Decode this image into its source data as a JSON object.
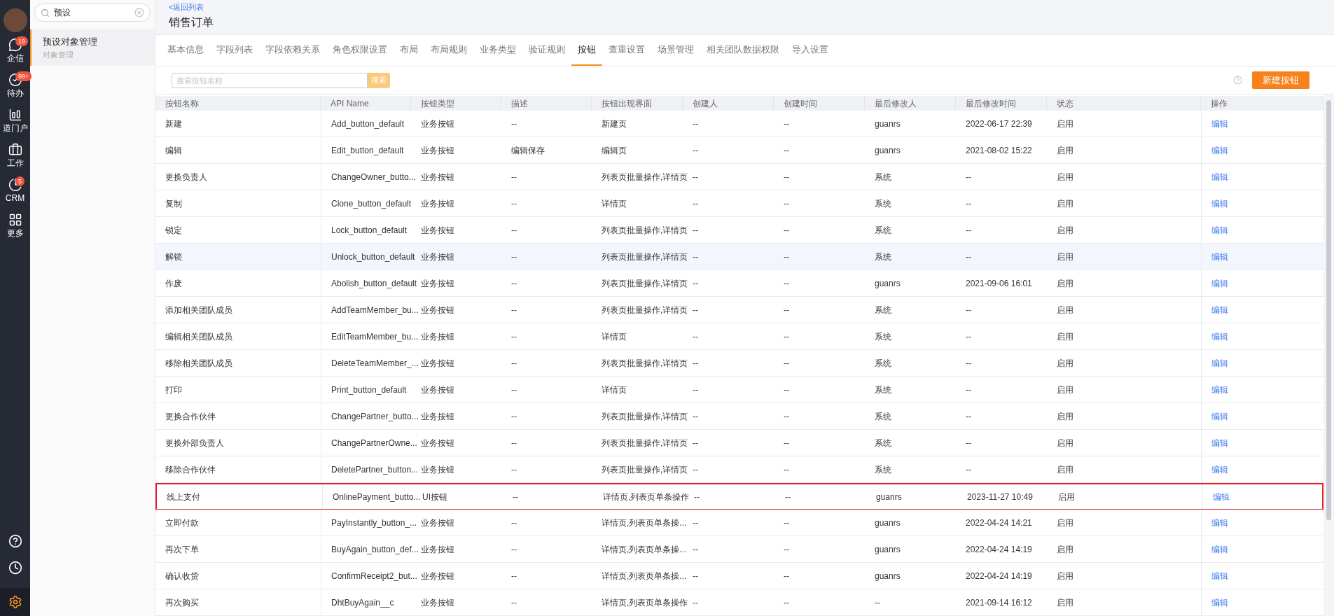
{
  "nav": {
    "items": [
      {
        "kind": "chat",
        "label": "企信",
        "badge": "19"
      },
      {
        "kind": "todo",
        "label": "待办",
        "badge": "99+"
      },
      {
        "kind": "portal",
        "label": "道门户"
      },
      {
        "kind": "work",
        "label": "工作"
      },
      {
        "kind": "crm",
        "label": "CRM",
        "badge": "5"
      },
      {
        "kind": "more",
        "label": "更多"
      }
    ]
  },
  "sidebar": {
    "search": {
      "value": "预设"
    },
    "items": [
      {
        "title": "预设对象管理",
        "subtitle": "对象管理",
        "selected": true
      }
    ]
  },
  "header": {
    "back_link": "<返回列表",
    "title": "销售订单"
  },
  "tabs": [
    {
      "label": "基本信息",
      "selected": false
    },
    {
      "label": "字段列表",
      "selected": false
    },
    {
      "label": "字段依赖关系",
      "selected": false
    },
    {
      "label": "角色权限设置",
      "selected": false
    },
    {
      "label": "布局",
      "selected": false
    },
    {
      "label": "布局规则",
      "selected": false
    },
    {
      "label": "业务类型",
      "selected": false
    },
    {
      "label": "验证规则",
      "selected": false
    },
    {
      "label": "按钮",
      "selected": true
    },
    {
      "label": "查重设置",
      "selected": false
    },
    {
      "label": "场景管理",
      "selected": false
    },
    {
      "label": "相关团队数据权限",
      "selected": false
    },
    {
      "label": "导入设置",
      "selected": false
    }
  ],
  "toolbar": {
    "search": {
      "placeholder": "搜索按钮名称"
    },
    "search_button": "搜索",
    "new_button": "新建按钮"
  },
  "table": {
    "columns": [
      "按钮名称",
      "API Name",
      "按钮类型",
      "描述",
      "按钮出现界面",
      "创建人",
      "创建时间",
      "最后修改人",
      "最后修改时间",
      "状态",
      "操作"
    ],
    "rows": [
      {
        "cells": [
          "新建",
          "Add_button_default",
          "业务按钮",
          "--",
          "新建页",
          "--",
          "--",
          "guanrs",
          "2022-06-17 22:39",
          "启用",
          "编辑"
        ],
        "hovered": false,
        "highlighted": false
      },
      {
        "cells": [
          "编辑",
          "Edit_button_default",
          "业务按钮",
          "编辑保存",
          "编辑页",
          "--",
          "--",
          "guanrs",
          "2021-08-02 15:22",
          "启用",
          "编辑"
        ],
        "hovered": false,
        "highlighted": false
      },
      {
        "cells": [
          "更换负责人",
          "ChangeOwner_butto...",
          "业务按钮",
          "--",
          "列表页批量操作,详情页",
          "--",
          "--",
          "系统",
          "--",
          "启用",
          "编辑"
        ],
        "hovered": false,
        "highlighted": false
      },
      {
        "cells": [
          "复制",
          "Clone_button_default",
          "业务按钮",
          "--",
          "详情页",
          "--",
          "--",
          "系统",
          "--",
          "启用",
          "编辑"
        ],
        "hovered": false,
        "highlighted": false
      },
      {
        "cells": [
          "锁定",
          "Lock_button_default",
          "业务按钮",
          "--",
          "列表页批量操作,详情页",
          "--",
          "--",
          "系统",
          "--",
          "启用",
          "编辑"
        ],
        "hovered": false,
        "highlighted": false
      },
      {
        "cells": [
          "解锁",
          "Unlock_button_default",
          "业务按钮",
          "--",
          "列表页批量操作,详情页",
          "--",
          "--",
          "系统",
          "--",
          "启用",
          "编辑"
        ],
        "hovered": true,
        "highlighted": false
      },
      {
        "cells": [
          "作废",
          "Abolish_button_default",
          "业务按钮",
          "--",
          "列表页批量操作,详情页",
          "--",
          "--",
          "guanrs",
          "2021-09-06 16:01",
          "启用",
          "编辑"
        ],
        "hovered": false,
        "highlighted": false
      },
      {
        "cells": [
          "添加相关团队成员",
          "AddTeamMember_bu...",
          "业务按钮",
          "--",
          "列表页批量操作,详情页",
          "--",
          "--",
          "系统",
          "--",
          "启用",
          "编辑"
        ],
        "hovered": false,
        "highlighted": false
      },
      {
        "cells": [
          "编辑相关团队成员",
          "EditTeamMember_bu...",
          "业务按钮",
          "--",
          "详情页",
          "--",
          "--",
          "系统",
          "--",
          "启用",
          "编辑"
        ],
        "hovered": false,
        "highlighted": false
      },
      {
        "cells": [
          "移除相关团队成员",
          "DeleteTeamMember_...",
          "业务按钮",
          "--",
          "列表页批量操作,详情页",
          "--",
          "--",
          "系统",
          "--",
          "启用",
          "编辑"
        ],
        "hovered": false,
        "highlighted": false
      },
      {
        "cells": [
          "打印",
          "Print_button_default",
          "业务按钮",
          "--",
          "详情页",
          "--",
          "--",
          "系统",
          "--",
          "启用",
          "编辑"
        ],
        "hovered": false,
        "highlighted": false
      },
      {
        "cells": [
          "更换合作伙伴",
          "ChangePartner_butto...",
          "业务按钮",
          "--",
          "列表页批量操作,详情页",
          "--",
          "--",
          "系统",
          "--",
          "启用",
          "编辑"
        ],
        "hovered": false,
        "highlighted": false
      },
      {
        "cells": [
          "更换外部负责人",
          "ChangePartnerOwne...",
          "业务按钮",
          "--",
          "列表页批量操作,详情页",
          "--",
          "--",
          "系统",
          "--",
          "启用",
          "编辑"
        ],
        "hovered": false,
        "highlighted": false
      },
      {
        "cells": [
          "移除合作伙伴",
          "DeletePartner_button...",
          "业务按钮",
          "--",
          "列表页批量操作,详情页",
          "--",
          "--",
          "系统",
          "--",
          "启用",
          "编辑"
        ],
        "hovered": false,
        "highlighted": false
      },
      {
        "cells": [
          "线上支付",
          "OnlinePayment_butto...",
          "UI按钮",
          "--",
          "详情页,列表页单条操作",
          "--",
          "--",
          "guanrs",
          "2023-11-27 10:49",
          "启用",
          "编辑"
        ],
        "hovered": false,
        "highlighted": true
      },
      {
        "cells": [
          "立即付款",
          "PayInstantly_button_...",
          "业务按钮",
          "--",
          "详情页,列表页单条操...",
          "--",
          "--",
          "guanrs",
          "2022-04-24 14:21",
          "启用",
          "编辑"
        ],
        "hovered": false,
        "highlighted": false
      },
      {
        "cells": [
          "再次下单",
          "BuyAgain_button_def...",
          "业务按钮",
          "--",
          "详情页,列表页单条操...",
          "--",
          "--",
          "guanrs",
          "2022-04-24 14:19",
          "启用",
          "编辑"
        ],
        "hovered": false,
        "highlighted": false
      },
      {
        "cells": [
          "确认收货",
          "ConfirmReceipt2_but...",
          "业务按钮",
          "--",
          "详情页,列表页单条操...",
          "--",
          "--",
          "guanrs",
          "2022-04-24 14:19",
          "启用",
          "编辑"
        ],
        "hovered": false,
        "highlighted": false
      },
      {
        "cells": [
          "再次购买",
          "DhtBuyAgain__c",
          "业务按钮",
          "--",
          "详情页,列表页单条操作",
          "--",
          "--",
          "--",
          "2021-09-14 16:12",
          "启用",
          "编辑"
        ],
        "hovered": false,
        "highlighted": false
      }
    ]
  }
}
